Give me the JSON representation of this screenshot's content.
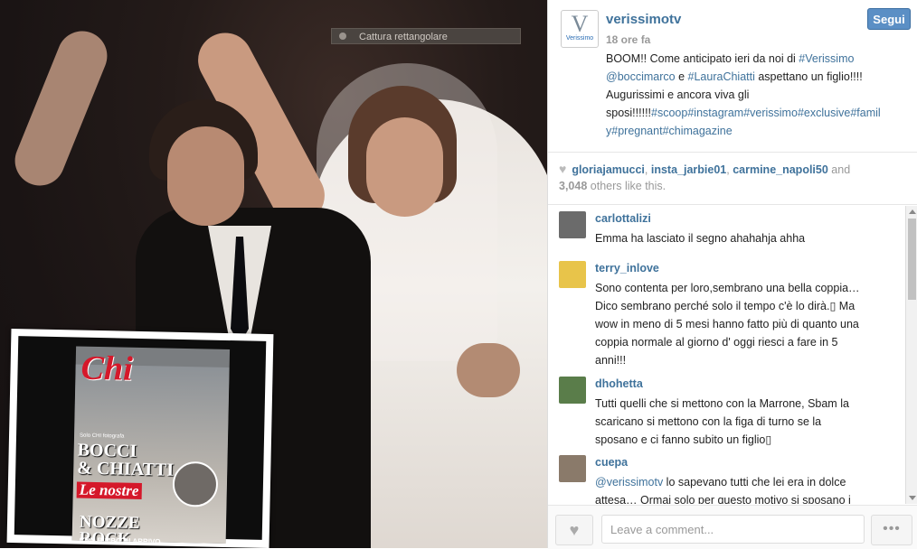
{
  "photo": {
    "tooltip_label": "Cattura rettangolare",
    "magazine": {
      "logo": "Chi",
      "kicker": "Solo CHI fotografa",
      "names_line1": "BOCCI",
      "names_line2": "& CHIATTI",
      "headline": "Le nostre",
      "rock_line1": "NOZZE",
      "rock_line2": "ROCK",
      "subline": "CON BIMBO IN ARRIVO"
    }
  },
  "post": {
    "username": "verissimotv",
    "avatar_text": "V",
    "avatar_subtext": "Verissimo",
    "time": "18 ore fa",
    "follow_label": "Segui",
    "caption_parts": [
      {
        "text": "BOOM!! Come anticipato ieri da noi di ",
        "tag": false
      },
      {
        "text": "#Verissimo",
        "tag": true
      },
      {
        "text": " ",
        "tag": false
      },
      {
        "text": "@boccimarco",
        "tag": true
      },
      {
        "text": " e ",
        "tag": false
      },
      {
        "text": "#LauraChiatti",
        "tag": true
      },
      {
        "text": " aspettano un figlio!!!! Augurissimi e ancora viva gli sposi!!!!!!",
        "tag": false
      },
      {
        "text": "#scoop",
        "tag": true
      },
      {
        "text": "#instagram",
        "tag": true
      },
      {
        "text": "#verissimo",
        "tag": true
      },
      {
        "text": "#exclusive",
        "tag": true
      },
      {
        "text": "#family",
        "tag": true
      },
      {
        "text": "#pregnant",
        "tag": true
      },
      {
        "text": "#chimagazine",
        "tag": true
      }
    ]
  },
  "likes": {
    "likers": [
      "gloriajamucci",
      "insta_jarbie01",
      "carmine_napoli50"
    ],
    "and_text": "and",
    "others_count": "3,048",
    "others_text": "others like this."
  },
  "comments": [
    {
      "user": "carlottalizi",
      "avatar_color": "#6b6b6b",
      "parts": [
        {
          "text": "Emma ha lasciato il segno ahahahja ahha",
          "tag": false
        }
      ]
    },
    {
      "user": "terry_inlove",
      "avatar_color": "#e8c44a",
      "parts": [
        {
          "text": "Sono contenta per loro,sembrano una bella coppia… Dico sembrano perché solo il tempo c'è lo dirà.▯ Ma wow in meno di 5 mesi hanno fatto più di quanto una coppia normale al giorno d' oggi riesci a fare in 5 anni!!!",
          "tag": false
        }
      ]
    },
    {
      "user": "dhohetta",
      "avatar_color": "#5a7d4a",
      "parts": [
        {
          "text": "Tutti quelli che si mettono con la Marrone, Sbam la scaricano si mettono con la figa di turno se la sposano e ci fanno subito un figlio▯",
          "tag": false
        }
      ]
    },
    {
      "user": "cuepa",
      "avatar_color": "#8a7a6a",
      "parts": [
        {
          "text": "@verissimotv",
          "tag": true
        },
        {
          "text": " lo sapevano tutti che lei era in dolce attesa… Ormai solo per questo motivo si sposano i",
          "tag": false
        }
      ]
    }
  ],
  "footer": {
    "comment_placeholder": "Leave a comment...",
    "more_label": "•••"
  },
  "colors": {
    "link": "#3f729b",
    "follow_button": "#5b8fc5"
  }
}
